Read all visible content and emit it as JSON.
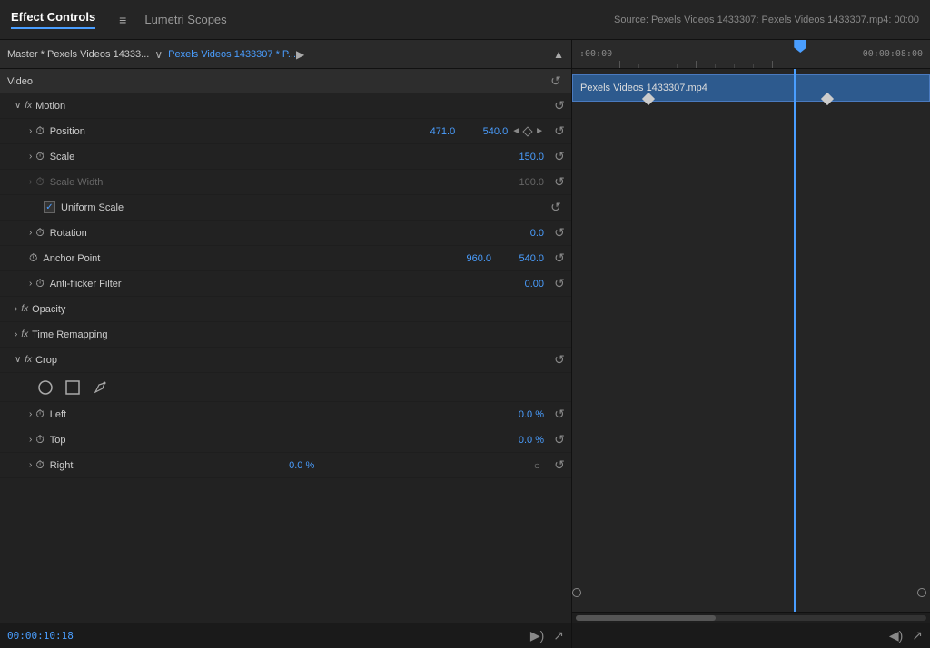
{
  "tabs": {
    "active": "Effect Controls",
    "inactive": "Lumetri Scopes",
    "menu_icon": "≡",
    "source": "Source: Pexels Videos 1433307: Pexels Videos 1433307.mp4: 00:00"
  },
  "source_header": {
    "master_label": "Master * Pexels Videos 14333...",
    "clip_label": "Pexels Videos 1433307 * P...",
    "chevron": "∨"
  },
  "sections": {
    "video_label": "Video",
    "motion_label": "Motion",
    "opacity_label": "Opacity",
    "time_remap_label": "Time Remapping",
    "crop_label": "Crop",
    "fx": "fx"
  },
  "properties": {
    "position": {
      "label": "Position",
      "x": "471.0",
      "y": "540.0"
    },
    "scale": {
      "label": "Scale",
      "value": "150.0"
    },
    "scale_width": {
      "label": "Scale Width",
      "value": "100.0"
    },
    "uniform_scale": {
      "label": "Uniform Scale",
      "checked": true
    },
    "rotation": {
      "label": "Rotation",
      "value": "0.0"
    },
    "anchor_point": {
      "label": "Anchor Point",
      "x": "960.0",
      "y": "540.0"
    },
    "anti_flicker": {
      "label": "Anti-flicker Filter",
      "value": "0.00"
    },
    "left": {
      "label": "Left",
      "value": "0.0 %"
    },
    "top": {
      "label": "Top",
      "value": "0.0 %"
    },
    "right": {
      "label": "Right",
      "value": "0.0 %"
    }
  },
  "timeline": {
    "clip_label": "Pexels Videos 1433307.mp4",
    "time_start": ":00:00",
    "time_end": "00:00:08:00"
  },
  "status": {
    "timecode": "00:00:10:18"
  }
}
